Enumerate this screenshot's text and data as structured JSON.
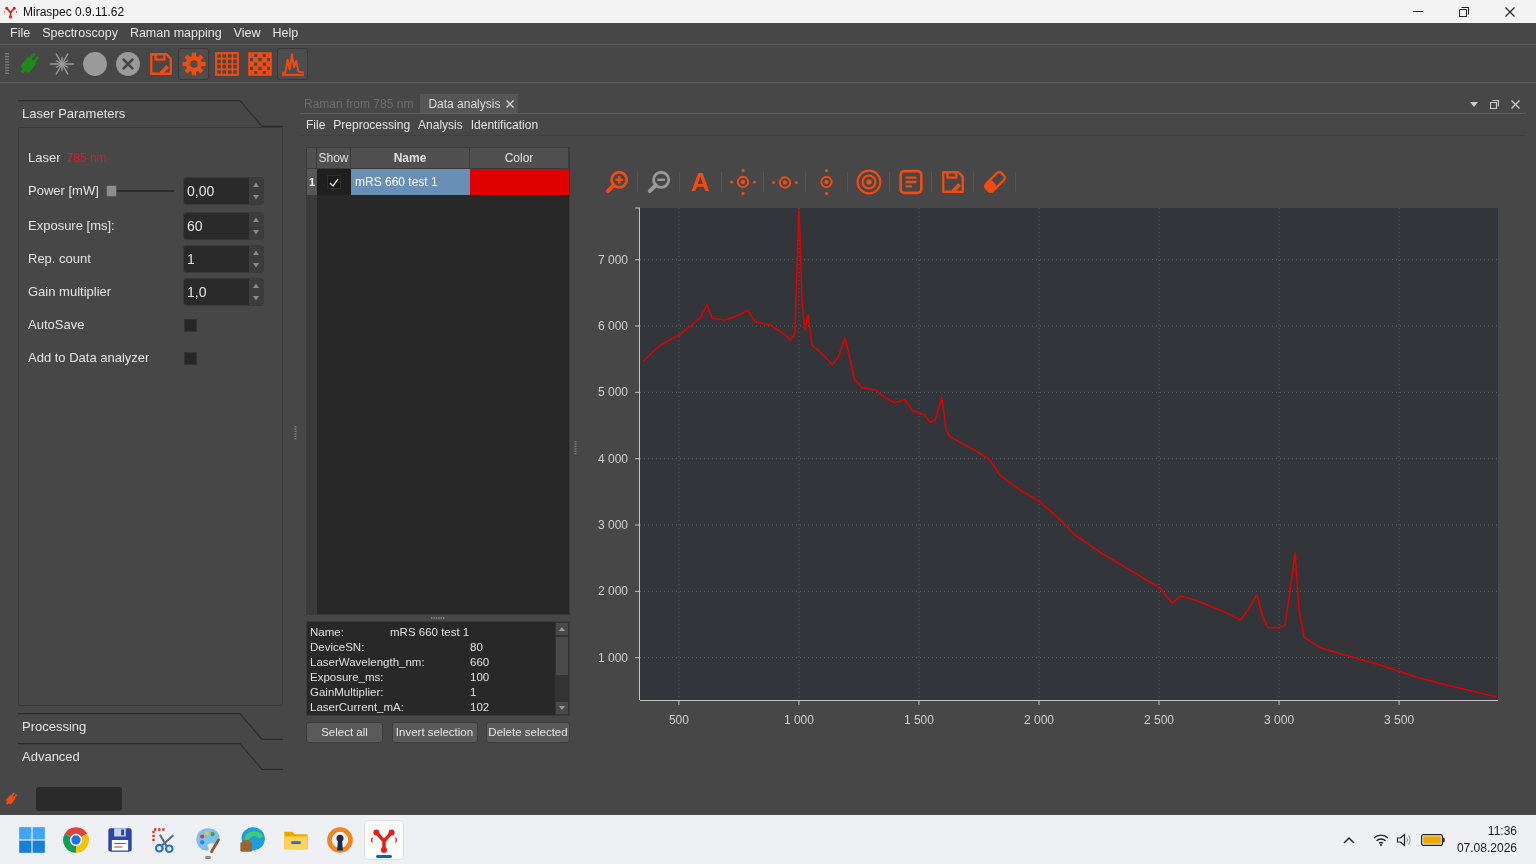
{
  "window": {
    "title": "Miraspec 0.9.11.62"
  },
  "menu": [
    "File",
    "Spectroscopy",
    "Raman mapping",
    "View",
    "Help"
  ],
  "toolbar": [
    {
      "kind": "plug",
      "disabled": false,
      "on": false
    },
    {
      "kind": "laser",
      "disabled": true,
      "on": false
    },
    {
      "kind": "record",
      "disabled": true,
      "on": false
    },
    {
      "kind": "stop",
      "disabled": true,
      "on": false
    },
    {
      "kind": "save",
      "disabled": false,
      "on": false
    },
    {
      "kind": "settings",
      "disabled": false,
      "on": true
    },
    {
      "kind": "grid",
      "disabled": false,
      "on": false
    },
    {
      "kind": "checker",
      "disabled": false,
      "on": false
    },
    {
      "kind": "spectrum",
      "disabled": false,
      "on": true
    }
  ],
  "sidebar": {
    "sections": [
      {
        "title": "Laser Parameters",
        "expanded": true,
        "fields": [
          {
            "kind": "reading",
            "label": "Laser",
            "value": "785 nm"
          },
          {
            "kind": "slider_spin",
            "label": "Power [mW]",
            "level": 0,
            "value": "0,00"
          },
          {
            "kind": "spin",
            "label": "Exposure [ms]:",
            "value": "60"
          },
          {
            "kind": "spin",
            "label": "Rep. count",
            "value": "1"
          },
          {
            "kind": "spin",
            "label": "Gain multiplier",
            "value": "1,0"
          },
          {
            "kind": "checkbox",
            "label": "AutoSave",
            "checked": false
          },
          {
            "kind": "checkbox",
            "label": "Add to Data analyzer",
            "checked": false
          }
        ]
      },
      {
        "title": "Processing",
        "expanded": false
      },
      {
        "title": "Advanced",
        "expanded": false
      }
    ]
  },
  "tabs": [
    {
      "label": "Raman from 785 nm",
      "selected": false,
      "closable": false
    },
    {
      "label": "Data analysis",
      "selected": true,
      "closable": true
    }
  ],
  "analysis_menu": [
    "File",
    "Preprocessing",
    "Analysis",
    "Identification"
  ],
  "spectra_table": {
    "columns": [
      {
        "label": "Show",
        "selected": false
      },
      {
        "label": "Name",
        "selected": true
      },
      {
        "label": "Color",
        "selected": false
      }
    ],
    "rows": [
      {
        "number": "1",
        "show": true,
        "name": "mRS 660 test 1",
        "color": "#e00000",
        "selected": true
      }
    ]
  },
  "metadata": [
    {
      "kind": "title",
      "key": "Name:",
      "value": "mRS 660 test 1"
    },
    {
      "kind": "field",
      "key": "DeviceSN:",
      "value": "80"
    },
    {
      "kind": "field",
      "key": "LaserWavelength_nm:",
      "value": "660"
    },
    {
      "kind": "field",
      "key": "Exposure_ms:",
      "value": "100"
    },
    {
      "kind": "field",
      "key": "GainMultiplier:",
      "value": "1"
    },
    {
      "kind": "field",
      "key": "LaserCurrent_mA:",
      "value": "102"
    }
  ],
  "table_buttons": [
    "Select all",
    "Invert selection",
    "Delete selected"
  ],
  "chart_toolbar": [
    {
      "kind": "zoom_in",
      "disabled": false
    },
    {
      "kind": "zoom_out",
      "disabled": true
    },
    {
      "kind": "text",
      "label": "A",
      "disabled": false
    },
    {
      "kind": "crosshair",
      "disabled": false
    },
    {
      "kind": "crosshair_h",
      "disabled": false
    },
    {
      "kind": "crosshair_v",
      "disabled": false
    },
    {
      "kind": "target",
      "disabled": false
    },
    {
      "kind": "document",
      "disabled": false
    },
    {
      "kind": "save",
      "disabled": false
    },
    {
      "kind": "eraser",
      "disabled": false
    }
  ],
  "chart": {
    "chart_data": {
      "type": "line",
      "grid": true,
      "x": [
        350,
        421,
        504,
        588,
        617,
        638,
        692,
        754,
        788,
        817,
        879,
        942,
        963,
        983,
        1000,
        1013,
        1025,
        1038,
        1054,
        1088,
        1121,
        1138,
        1163,
        1192,
        1213,
        1233,
        1263,
        1317,
        1358,
        1400,
        1442,
        1471,
        1525,
        1546,
        1567,
        1596,
        1613,
        1629,
        1671,
        1733,
        1796,
        1838,
        1921,
        2004,
        2088,
        2150,
        2254,
        2379,
        2504,
        2554,
        2588,
        2650,
        2754,
        2838,
        2871,
        2908,
        2929,
        2954,
        2996,
        3025,
        3046,
        3067,
        3083,
        3104,
        3171,
        3275,
        3421,
        3588,
        3754,
        3904
      ],
      "series": [
        {
          "color": "#e00000",
          "values": [
            5460,
            5710,
            5870,
            6120,
            6320,
            6120,
            6090,
            6170,
            6240,
            6060,
            6020,
            5870,
            5790,
            5870,
            7750,
            6390,
            5940,
            6170,
            5710,
            5610,
            5490,
            5410,
            5520,
            5820,
            5490,
            5190,
            5070,
            5040,
            4920,
            4840,
            4890,
            4730,
            4660,
            4550,
            4580,
            4920,
            4430,
            4330,
            4250,
            4130,
            3980,
            3750,
            3530,
            3350,
            3080,
            2850,
            2590,
            2320,
            2050,
            1820,
            1930,
            1870,
            1720,
            1570,
            1720,
            1950,
            1640,
            1450,
            1450,
            1490,
            2020,
            2580,
            1720,
            1310,
            1150,
            1040,
            890,
            690,
            540,
            410
          ]
        }
      ],
      "xlim": [
        338,
        3912
      ],
      "ylim": [
        362,
        7779
      ],
      "xticks": [
        {
          "value": 500,
          "label": "500"
        },
        {
          "value": 1000,
          "label": "1 000"
        },
        {
          "value": 1500,
          "label": "1 500"
        },
        {
          "value": 2000,
          "label": "2 000"
        },
        {
          "value": 2500,
          "label": "2 500"
        },
        {
          "value": 3000,
          "label": "3 000"
        },
        {
          "value": 3500,
          "label": "3 500"
        }
      ],
      "yticks": [
        {
          "value": 1000,
          "label": "1 000"
        },
        {
          "value": 2000,
          "label": "2 000"
        },
        {
          "value": 3000,
          "label": "3 000"
        },
        {
          "value": 4000,
          "label": "4 000"
        },
        {
          "value": 5000,
          "label": "5 000"
        },
        {
          "value": 6000,
          "label": "6 000"
        },
        {
          "value": 7000,
          "label": "7 000"
        }
      ]
    }
  },
  "taskbar": {
    "apps": [
      {
        "kind": "start",
        "running": false,
        "selected": false
      },
      {
        "kind": "browser",
        "running": false,
        "selected": false
      },
      {
        "kind": "disk",
        "running": false,
        "selected": false
      },
      {
        "kind": "snip",
        "running": false,
        "selected": false
      },
      {
        "kind": "paint",
        "running": true,
        "selected": false
      },
      {
        "kind": "edge",
        "running": false,
        "selected": false
      },
      {
        "kind": "folder",
        "running": false,
        "selected": false
      },
      {
        "kind": "vpn",
        "running": false,
        "selected": false
      },
      {
        "kind": "app",
        "running": true,
        "selected": true
      }
    ],
    "clock": {
      "time": "11:36",
      "date": "07.08.2026"
    }
  }
}
